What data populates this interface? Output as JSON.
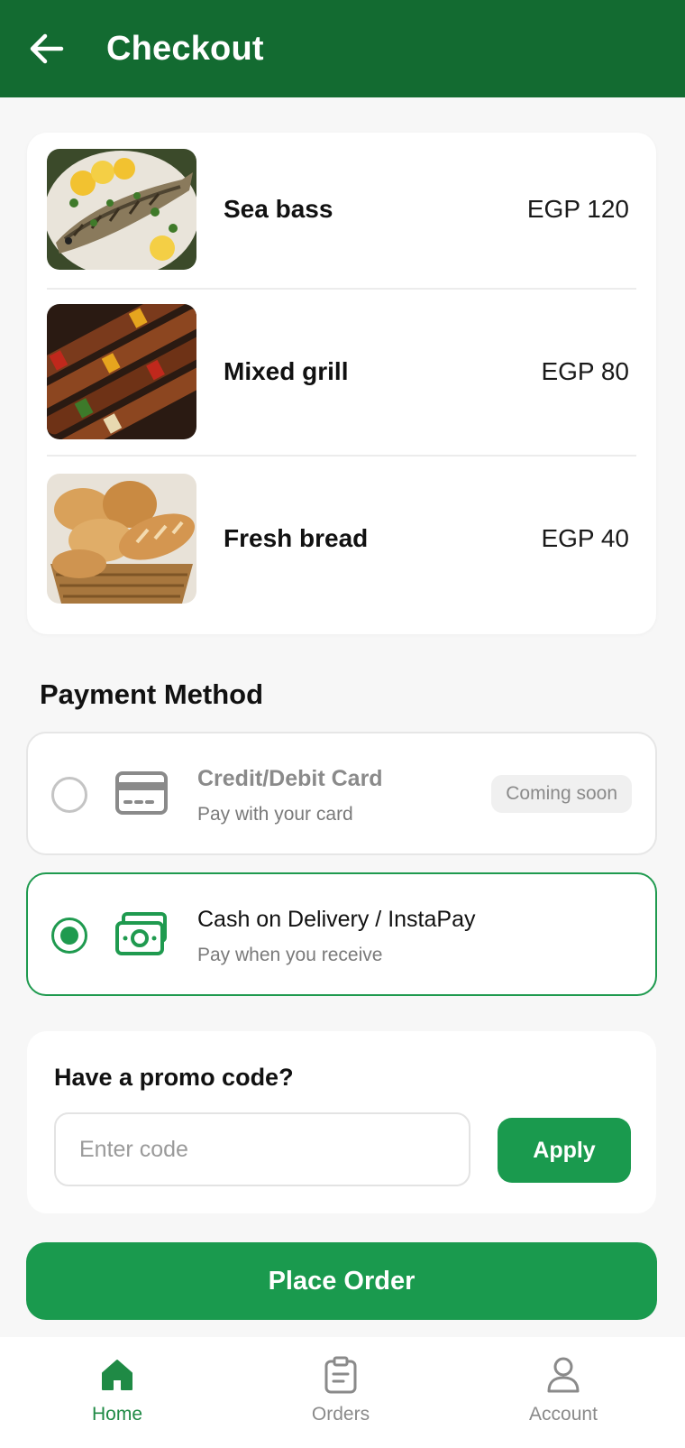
{
  "header": {
    "title": "Checkout",
    "back_icon": "arrow-left-icon"
  },
  "order_items": [
    {
      "name": "Sea bass",
      "price": "EGP 120",
      "image": "grilled-fish-photo"
    },
    {
      "name": "Mixed grill",
      "price": "EGP 80",
      "image": "kebab-skewers-photo"
    },
    {
      "name": "Fresh bread",
      "price": "EGP 40",
      "image": "bread-basket-photo"
    }
  ],
  "payment": {
    "section_title": "Payment Method",
    "options": [
      {
        "title": "Credit/Debit Card",
        "subtitle": "Pay with your card",
        "badge": "Coming soon",
        "icon": "credit-card-icon",
        "selected": false,
        "disabled": true
      },
      {
        "title": "Cash on Delivery / InstaPay",
        "subtitle": "Pay when you receive",
        "icon": "cash-icon",
        "selected": true,
        "disabled": false
      }
    ]
  },
  "promo": {
    "title": "Have a promo code?",
    "placeholder": "Enter code",
    "value": "",
    "apply_label": "Apply"
  },
  "place_order_label": "Place Order",
  "bottom_nav": {
    "items": [
      {
        "label": "Home",
        "icon": "home-icon",
        "active": true
      },
      {
        "label": "Orders",
        "icon": "clipboard-icon",
        "active": false
      },
      {
        "label": "Account",
        "icon": "person-icon",
        "active": false
      }
    ]
  },
  "colors": {
    "header_bg": "#136b31",
    "accent": "#1a9a4e",
    "page_bg": "#f7f7f7"
  }
}
